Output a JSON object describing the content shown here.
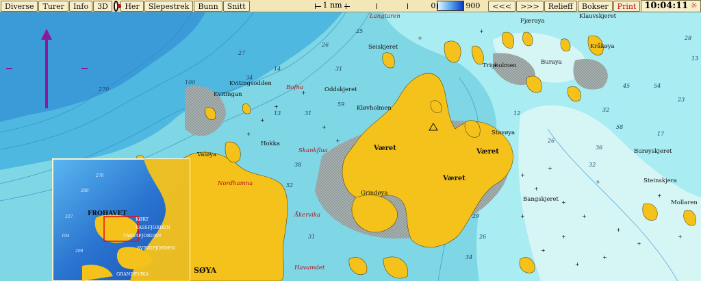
{
  "toolbar": {
    "buttons": [
      "Diverse",
      "Turer",
      "Info",
      "3D",
      "Her",
      "Slepestrek",
      "Bunn",
      "Snitt"
    ],
    "scale_label": "1 nm",
    "depth_min": "0",
    "depth_max": "900",
    "prev_label": "<<<",
    "next_label": ">>>",
    "relief_label": "Relieff",
    "boxes_label": "Bokser",
    "print_label": "Print",
    "time": "10:04:11"
  },
  "colors": {
    "land": "#f4c21a",
    "shallow_water": "#a9ecf2",
    "deep_water": "#3cb1dc",
    "very_deep_water": "#2f8fd3",
    "drying_area": "#9aa6a6",
    "red_label": "#b0101a",
    "route_marker": "#8a1a98"
  },
  "map": {
    "place_labels": [
      "Langtaren",
      "Seiskjeret",
      "Klauvskjeret",
      "Fjæraya",
      "Kråkøya",
      "Trigholmen",
      "Buraya",
      "Kvitingsodden",
      "Kvitingan",
      "Bofna",
      "Oddskjeret",
      "Kløvholmen",
      "Stavøya",
      "Været",
      "Været",
      "Været",
      "Hokka",
      "Skankflua",
      "Valøya",
      "Grindøya",
      "Nordhamna",
      "Åkervika",
      "Havamdet",
      "SØYA",
      "Burøyskjeret",
      "Steinskjera",
      "Bangskjeret",
      "Mollaren"
    ],
    "depth_soundings": [
      "25",
      "27",
      "100",
      "270",
      "26",
      "31",
      "31",
      "59",
      "14",
      "34",
      "13",
      "38",
      "52",
      "31",
      "32",
      "45",
      "58",
      "54",
      "36",
      "32",
      "28",
      "13",
      "29",
      "26",
      "34",
      "12",
      "26",
      "23",
      "17"
    ]
  },
  "inset": {
    "labels": [
      "FROHAVET",
      "KØRT",
      "VASSFJORDEN",
      "TARVAFJORDEN",
      "SVINGFJORDEN",
      "GRANDEVIKA"
    ],
    "soundings": [
      "327",
      "280",
      "194",
      "208",
      "278"
    ]
  }
}
